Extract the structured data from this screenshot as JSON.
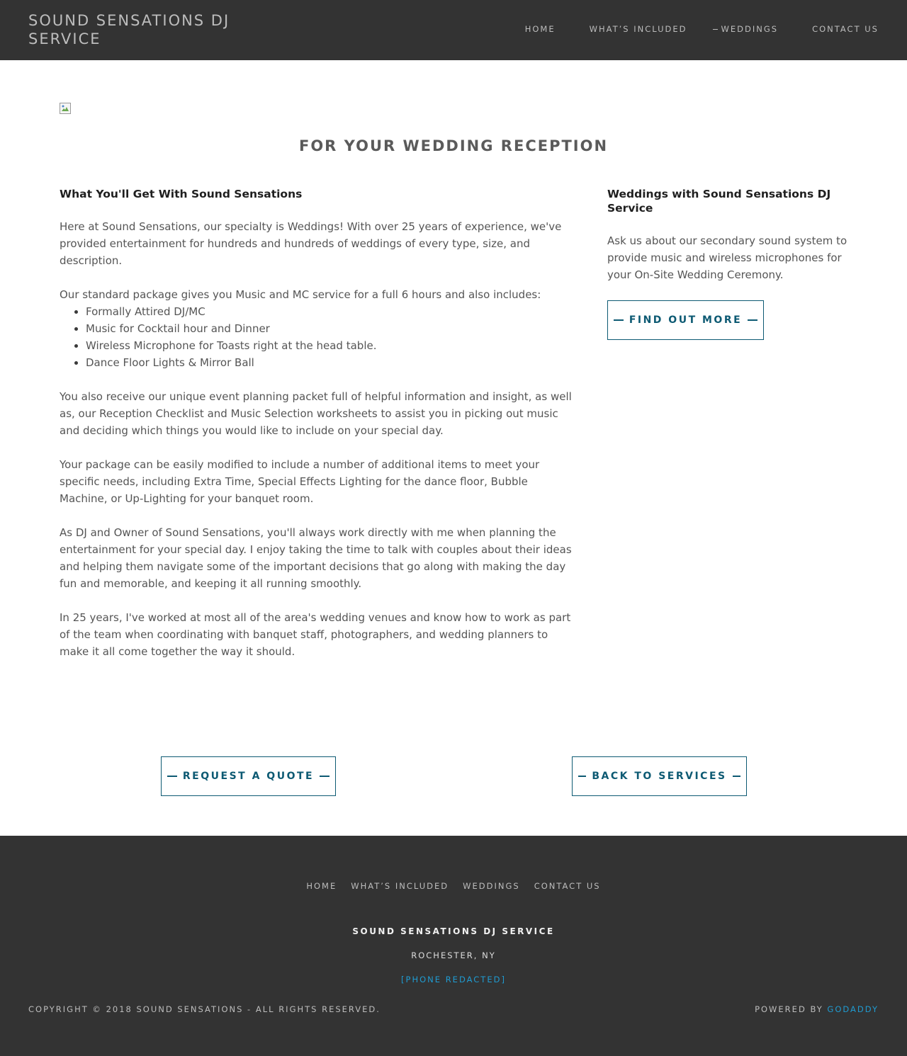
{
  "header": {
    "brand": "SOUND SENSATIONS DJ SERVICE",
    "nav": {
      "home": "HOME",
      "whats_included": "WHAT’S INCLUDED",
      "weddings": "WEDDINGS",
      "contact": "CONTACT US"
    }
  },
  "main": {
    "image_icon": "broken-image-icon",
    "title": "FOR YOUR WEDDING RECEPTION",
    "left": {
      "heading": "What You'll Get With Sound Sensations",
      "p1": "Here at Sound Sensations, our specialty is Weddings!  With over 25 years of experience, we've provided entertainment for hundreds and hundreds of weddings of every type, size, and description.",
      "p2": "Our standard package gives you Music and MC service for a full 6 hours and also includes:",
      "list": [
        "Formally Attired DJ/MC",
        "Music for Cocktail hour and Dinner",
        "Wireless Microphone for Toasts right at the head table.",
        "Dance Floor Lights & Mirror Ball"
      ],
      "p3": "You also receive our unique event planning packet full of helpful information and insight, as well as, our Reception Checklist and Music Selection worksheets to assist you in picking out music and deciding which things you would like to include on your special day.",
      "p4": "Your package can be easily modified to include a number of additional items to meet your specific needs, including Extra Time, Special Effects Lighting for the dance floor, Bubble Machine, or Up-Lighting for your banquet room.",
      "p5": "As DJ and Owner of Sound Sensations, you'll always work directly with me when planning the entertainment for your special day.  I enjoy taking the time to talk with couples about their ideas and helping them navigate some of the important decisions that go along with making the day fun and memorable, and keeping it all running smoothly.",
      "p6": "In 25 years, I've worked at most all of the area's wedding venues and know how to work as part of the team when coordinating with banquet staff, photographers, and wedding planners to make it all come together the way it should."
    },
    "right": {
      "heading": "Weddings with Sound Sensations DJ Service",
      "text": "Ask us about our secondary sound system to provide music and wireless microphones for your On-Site Wedding Ceremony.",
      "button": "FIND OUT MORE"
    },
    "buttons": {
      "quote": "REQUEST A QUOTE",
      "back": "BACK TO SERVICES"
    }
  },
  "footer": {
    "nav": {
      "home": "HOME",
      "whats_included": "WHAT’S INCLUDED",
      "weddings": "WEDDINGS",
      "contact": "CONTACT US"
    },
    "name": "SOUND SENSATIONS DJ SERVICE",
    "city": "ROCHESTER, NY",
    "phone": "[PHONE REDACTED]",
    "copyright": "COPYRIGHT © 2018 SOUND SENSATIONS - ALL RIGHTS RESERVED.",
    "powered_by": "POWERED BY",
    "godaddy": "GODADDY"
  },
  "colors": {
    "header_bg": "#333333",
    "accent": "#0d5a73",
    "link": "#1f9bd1"
  }
}
